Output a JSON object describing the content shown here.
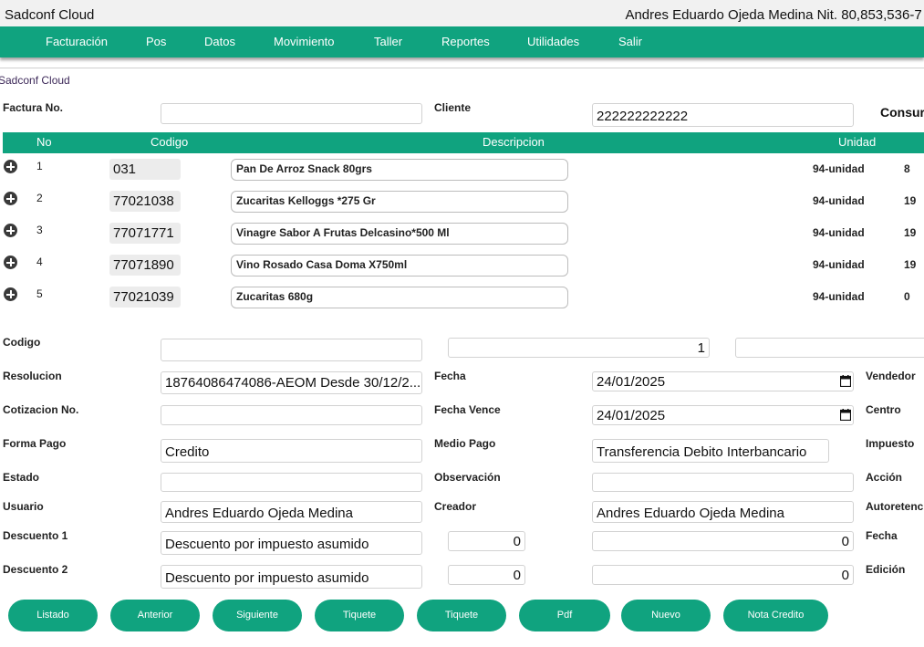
{
  "app": {
    "title": "Sadconf Cloud",
    "user_info": "Andres Eduardo Ojeda Medina Nit. 80,853,536-7 /"
  },
  "menu": [
    "Facturación",
    "Pos",
    "Datos",
    "Movimiento",
    "Taller",
    "Reportes",
    "Utilidades",
    "Salir"
  ],
  "breadcrumb": "Sadconf Cloud",
  "header": {
    "factura_label": "Factura No.",
    "factura_value": "",
    "cliente_label": "Cliente",
    "cliente_value": "222222222222",
    "cliente_extra": "Consur"
  },
  "grid": {
    "columns": [
      "No",
      "Codigo",
      "Descripcion",
      "Unidad"
    ],
    "rows": [
      {
        "no": "1",
        "code": "031",
        "desc": "Pan De Arroz Snack 80grs",
        "unit": "94-unidad",
        "qty": "8"
      },
      {
        "no": "2",
        "code": "77021038",
        "desc": "Zucaritas Kelloggs *275 Gr",
        "unit": "94-unidad",
        "qty": "19"
      },
      {
        "no": "3",
        "code": "77071771",
        "desc": "Vinagre Sabor A Frutas Delcasino*500 Ml",
        "unit": "94-unidad",
        "qty": "19"
      },
      {
        "no": "4",
        "code": "77071890",
        "desc": "Vino Rosado Casa Doma X750ml",
        "unit": "94-unidad",
        "qty": "19"
      },
      {
        "no": "5",
        "code": "77021039",
        "desc": "Zucaritas 680g",
        "unit": "94-unidad",
        "qty": "0"
      }
    ]
  },
  "form": {
    "codigo_label": "Codigo",
    "codigo_value": "",
    "cantidad_value": "1",
    "resolucion_label": "Resolucion",
    "resolucion_value": "18764086474086-AEOM Desde 30/12/2...",
    "fecha_label": "Fecha",
    "fecha_value": "24/01/2025",
    "vendedor_label": "Vendedor",
    "cotizacion_label": "Cotizacion No.",
    "fecha_vence_label": "Fecha Vence",
    "fecha_vence_value": "24/01/2025",
    "centro_label": "Centro",
    "forma_pago_label": "Forma Pago",
    "forma_pago_value": "Credito",
    "medio_pago_label": "Medio Pago",
    "medio_pago_value": "Transferencia Debito Interbancario",
    "impuesto_label": "Impuesto",
    "estado_label": "Estado",
    "observacion_label": "Observación",
    "accion_label": "Acción",
    "usuario_label": "Usuario",
    "usuario_value": "Andres Eduardo Ojeda Medina",
    "creador_label": "Creador",
    "creador_value": "Andres Eduardo Ojeda Medina",
    "autoretenc_label": "Autoretenc",
    "descuento1_label": "Descuento 1",
    "descuento1_value": "Descuento por impuesto asumido",
    "descuento1_pct": "0",
    "descuento1_amount": "0",
    "fecha2_label": "Fecha",
    "descuento2_label": "Descuento 2",
    "descuento2_value": "Descuento por impuesto asumido",
    "descuento2_pct": "0",
    "descuento2_amount": "0",
    "edicion_label": "Edición"
  },
  "buttons": [
    "Listado",
    "Anterior",
    "Siguiente",
    "Tiquete",
    "Tiquete",
    "Pdf",
    "Nuevo",
    "Nota Credito"
  ],
  "colors": {
    "accent": "#10a37f"
  }
}
